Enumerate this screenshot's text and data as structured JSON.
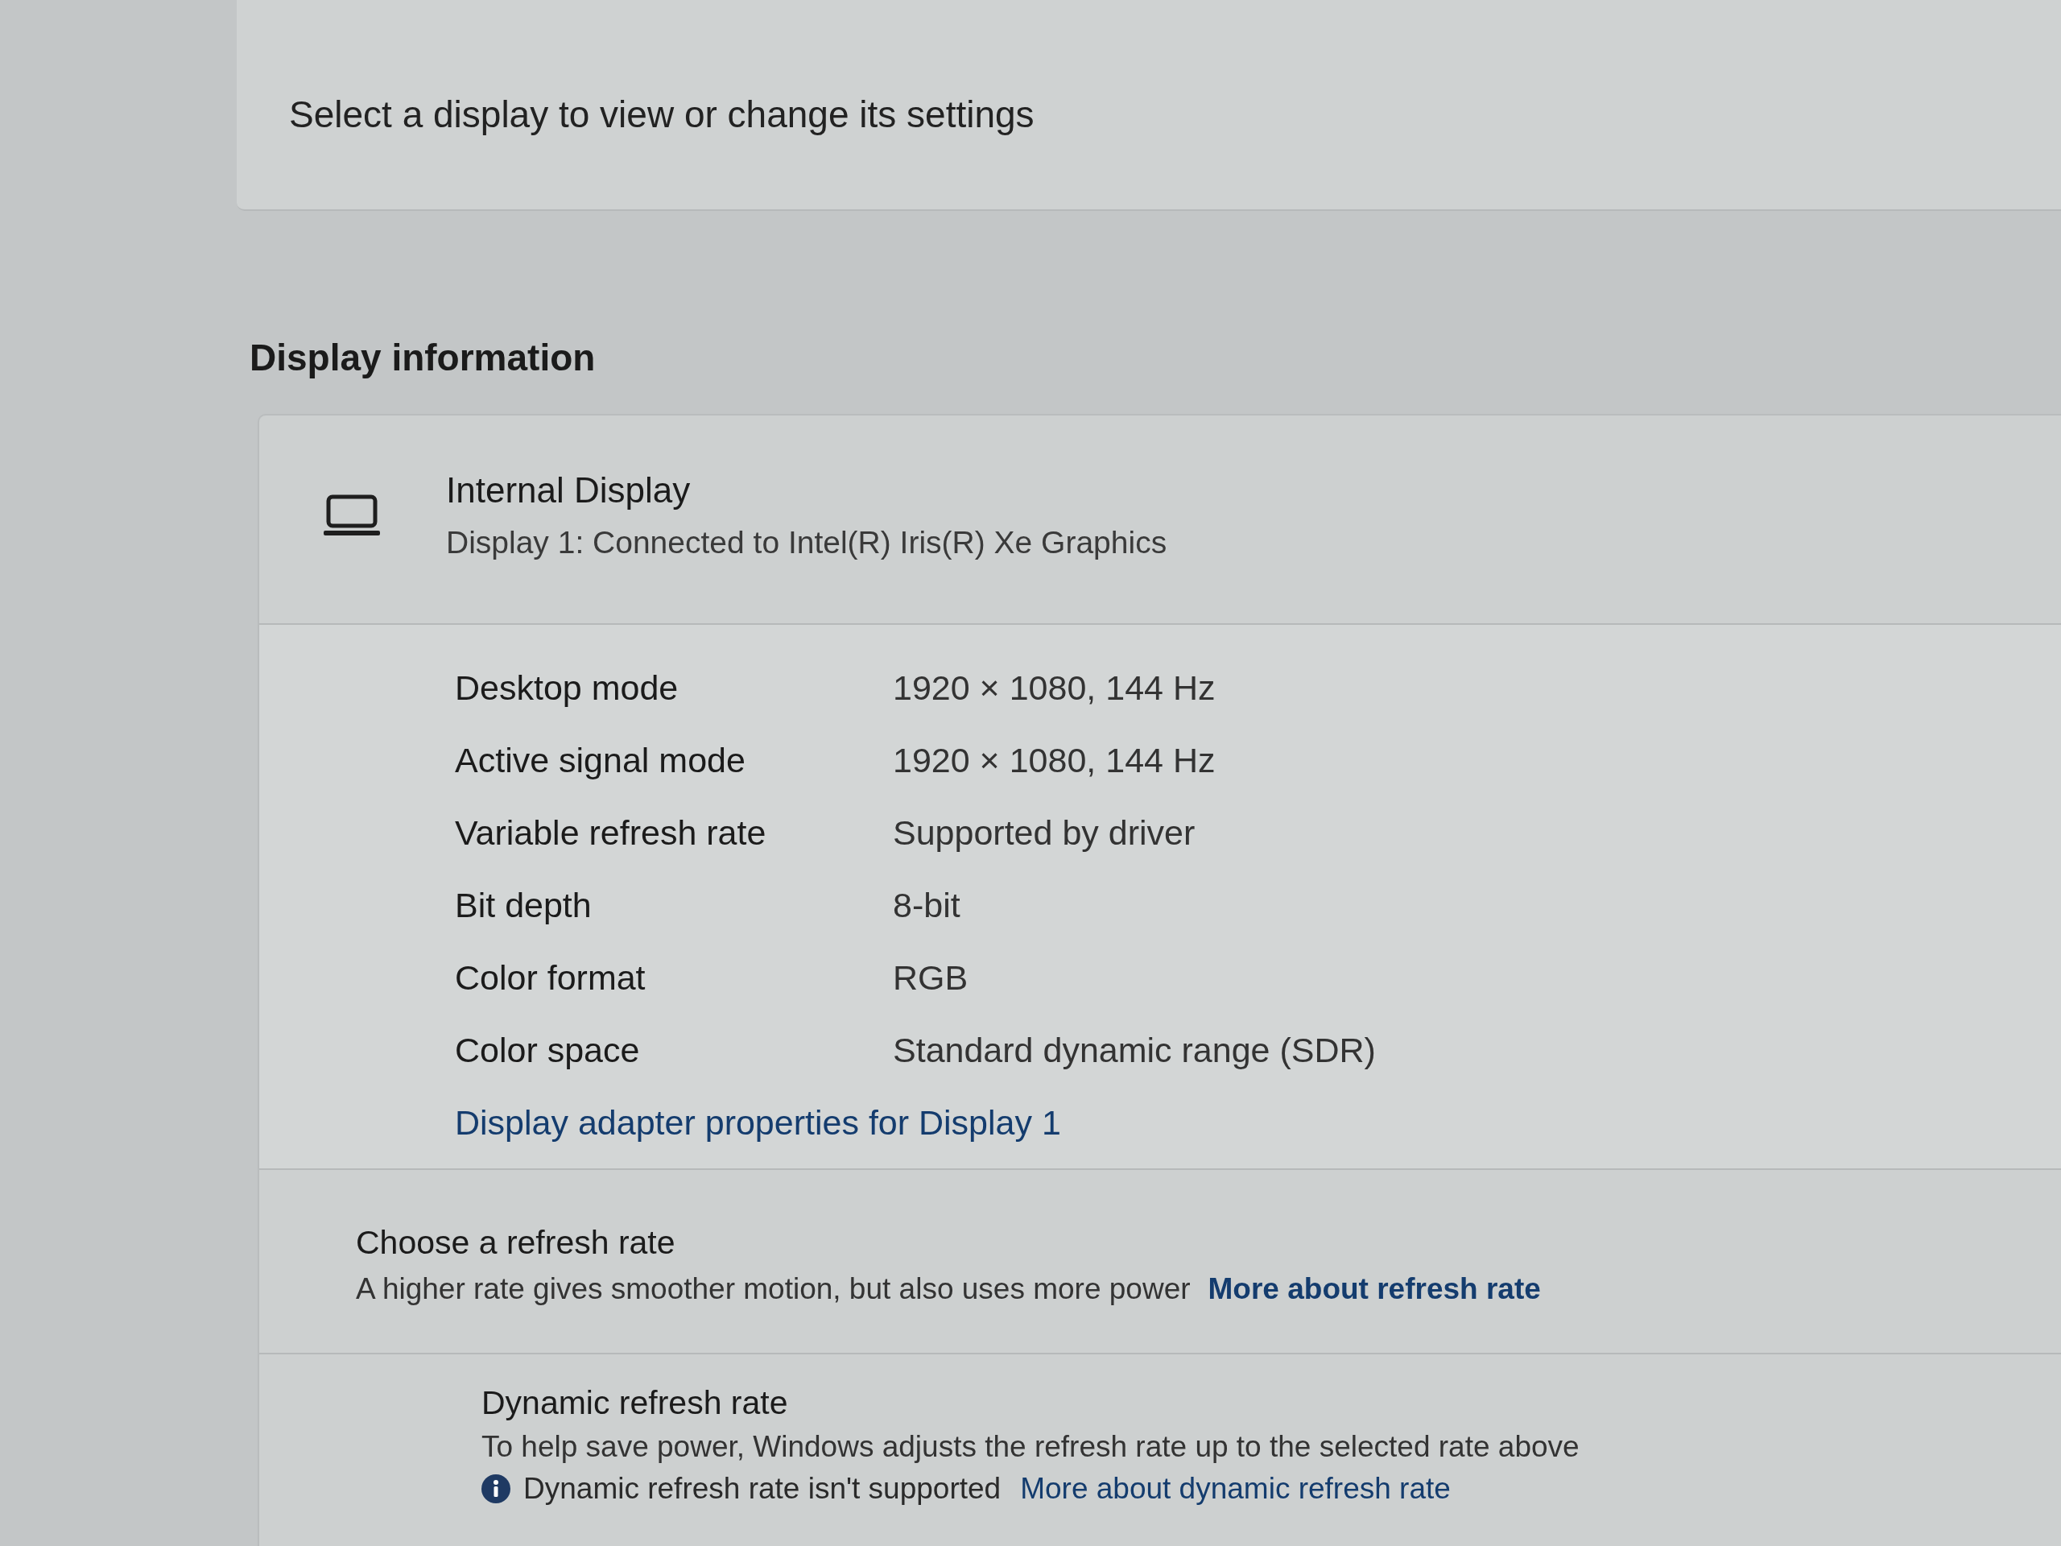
{
  "display_picker": {
    "prompt": "Select a display to view or change its settings"
  },
  "section_title": "Display information",
  "display": {
    "name": "Internal Display",
    "subtitle": "Display 1: Connected to Intel(R) Iris(R) Xe Graphics"
  },
  "properties": [
    {
      "label": "Desktop mode",
      "value": "1920 × 1080, 144 Hz"
    },
    {
      "label": "Active signal mode",
      "value": "1920 × 1080, 144 Hz"
    },
    {
      "label": "Variable refresh rate",
      "value": "Supported by driver"
    },
    {
      "label": "Bit depth",
      "value": "8-bit"
    },
    {
      "label": "Color format",
      "value": "RGB"
    },
    {
      "label": "Color space",
      "value": "Standard dynamic range (SDR)"
    }
  ],
  "adapter_link": "Display adapter properties for Display 1",
  "refresh_rate": {
    "title": "Choose a refresh rate",
    "description": "A higher rate gives smoother motion, but also uses more power",
    "link": "More about refresh rate"
  },
  "dynamic_refresh": {
    "title": "Dynamic refresh rate",
    "description": "To help save power, Windows adjusts the refresh rate up to the selected rate above",
    "notice": "Dynamic refresh rate isn't supported",
    "link": "More about dynamic refresh rate"
  }
}
